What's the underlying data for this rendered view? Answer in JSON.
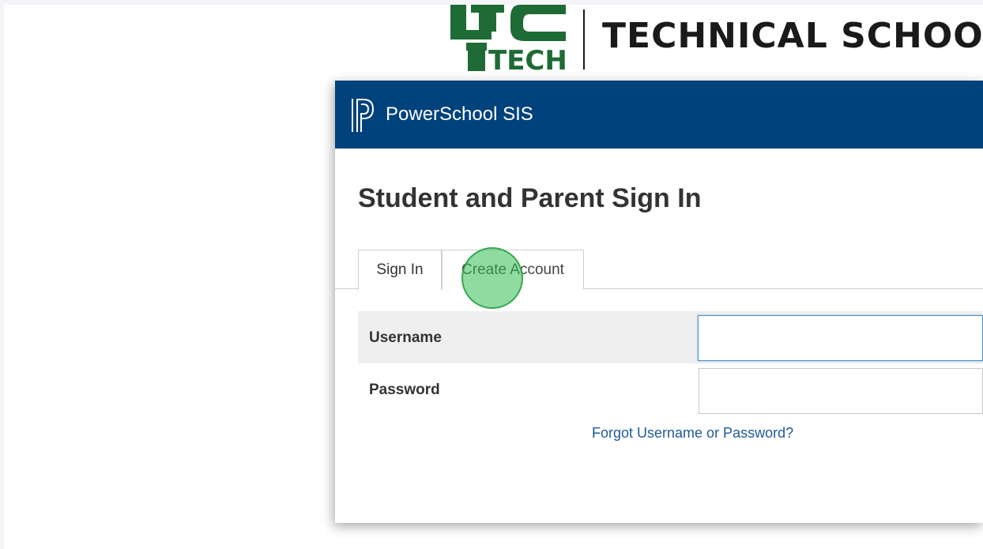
{
  "logo": {
    "mark_icon": "ltc-tech-logo-icon",
    "mark_text": "TECH",
    "school_name": "TECHNICAL SCHOOL",
    "mark_color": "#1f6b35"
  },
  "header": {
    "brand_icon": "powerschool-logo-icon",
    "brand_name": "PowerSchool SIS",
    "background_color": "#00427c"
  },
  "page": {
    "title": "Student and Parent Sign In"
  },
  "tabs": [
    {
      "label": "Sign In",
      "active": true
    },
    {
      "label": "Create Account",
      "active": false
    }
  ],
  "form": {
    "username": {
      "label": "Username",
      "value": "",
      "placeholder": ""
    },
    "password": {
      "label": "Password",
      "value": "",
      "placeholder": ""
    },
    "forgot_link": "Forgot Username or Password?"
  },
  "click_indicator": {
    "icon": "click-highlight-circle",
    "color": "#34be50"
  }
}
